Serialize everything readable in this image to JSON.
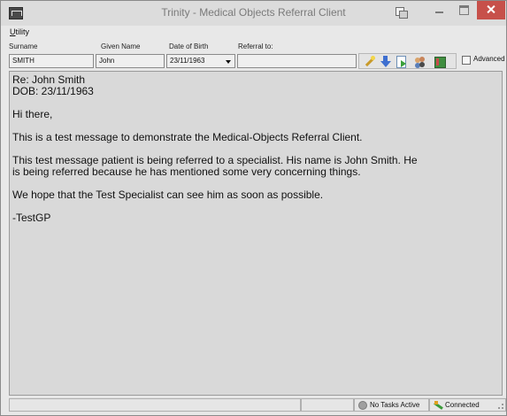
{
  "window": {
    "title": "Trinity - Medical Objects Referral Client"
  },
  "menu": {
    "utility_underline": "U",
    "utility_rest": "tility"
  },
  "form": {
    "surname_label": "Surname",
    "surname_value": "SMITH",
    "given_name_label": "Given Name",
    "given_name_value": "John",
    "dob_label": "Date of Birth",
    "dob_value": "23/11/1963",
    "referral_label": "Referral to:",
    "referral_value": "",
    "advanced_label": "Advanced",
    "advanced_checked": false
  },
  "toolbar": {
    "icons": [
      "magic-wand-icon",
      "download-arrow-icon",
      "document-send-icon",
      "users-icon",
      "address-book-icon"
    ]
  },
  "message": {
    "lines": {
      "re": "Re: John Smith",
      "dob": "DOB: 23/11/1963",
      "greeting": "Hi there,",
      "p1": "This is a test message to demonstrate the Medical-Objects Referral Client.",
      "p2a": "This test message patient is being referred to a specialist. His name is John Smith. He",
      "p2b": "is being referred because he has mentioned some very concerning things.",
      "p3": "We hope that the Test Specialist can see him as soon as possible.",
      "sign": "-TestGP"
    }
  },
  "status": {
    "tasks": "No Tasks Active",
    "connection": "Connected"
  }
}
